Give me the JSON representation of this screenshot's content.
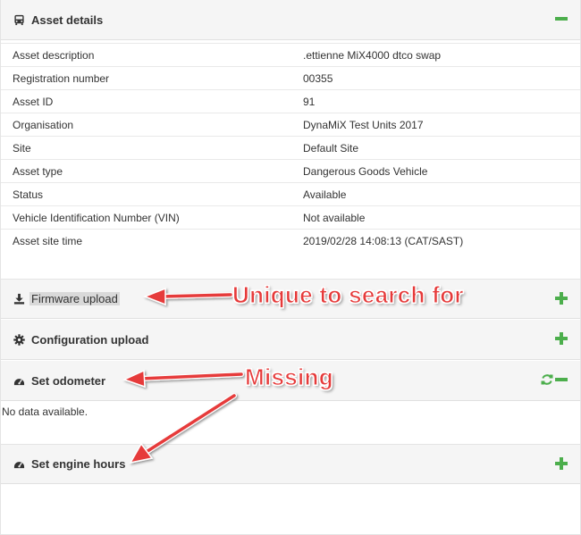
{
  "colors": {
    "accent": "#4cae4c",
    "annotation": "#e63a3a",
    "header_bg": "#f5f5f5"
  },
  "asset_details": {
    "title": "Asset details",
    "icon": "bus-icon",
    "rows": [
      {
        "label": "Asset description",
        "value": ".ettienne MiX4000 dtco swap"
      },
      {
        "label": "Registration number",
        "value": "00355"
      },
      {
        "label": "Asset ID",
        "value": "91"
      },
      {
        "label": "Organisation",
        "value": "DynaMiX Test Units 2017"
      },
      {
        "label": "Site",
        "value": "Default Site"
      },
      {
        "label": "Asset type",
        "value": "Dangerous Goods Vehicle"
      },
      {
        "label": "Status",
        "value": "Available"
      },
      {
        "label": "Vehicle Identification Number (VIN)",
        "value": "Not available"
      },
      {
        "label": "Asset site time",
        "value": "2019/02/28 14:08:13 (CAT/SAST)"
      }
    ]
  },
  "firmware_upload": {
    "title": "Firmware upload",
    "icon": "download-icon"
  },
  "configuration_upload": {
    "title": "Configuration upload",
    "icon": "gear-icon"
  },
  "set_odometer": {
    "title": "Set odometer",
    "icon": "dashboard-icon",
    "empty_text": "No data available."
  },
  "set_engine_hours": {
    "title": "Set engine hours",
    "icon": "dashboard-icon"
  },
  "annotations": {
    "unique": "Unique to search for",
    "missing": "Missing"
  }
}
